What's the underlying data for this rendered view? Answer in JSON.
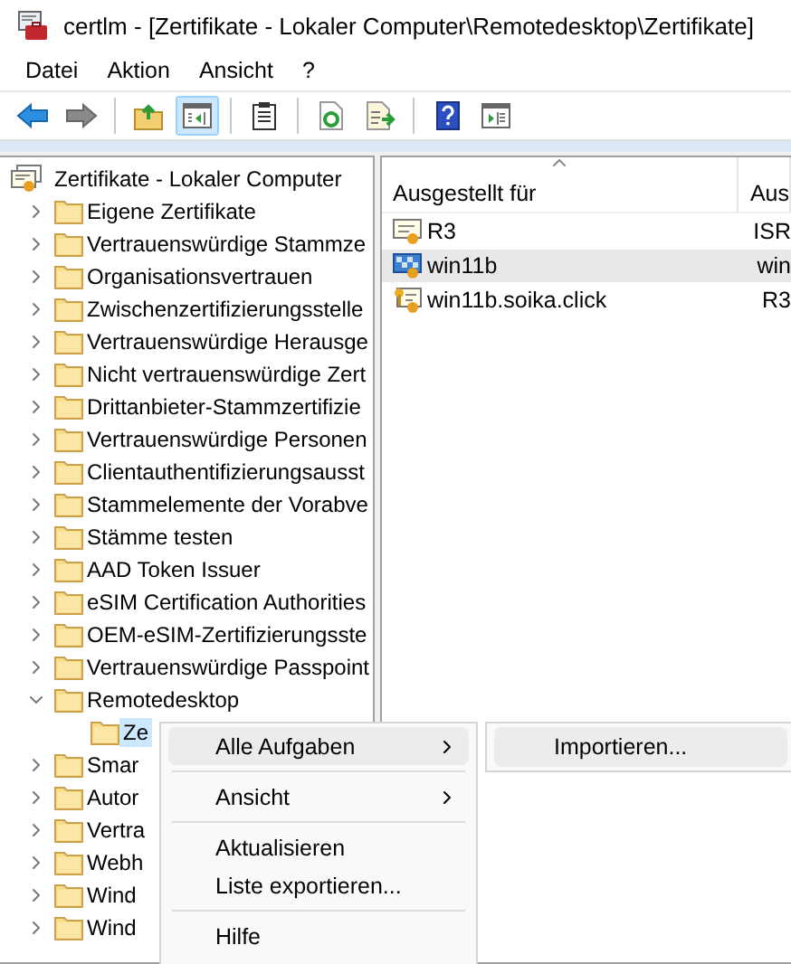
{
  "window": {
    "title": "certlm - [Zertifikate - Lokaler Computer\\Remotedesktop\\Zertifikate]"
  },
  "menu": [
    "Datei",
    "Aktion",
    "Ansicht",
    "?"
  ],
  "toolbar": [
    {
      "kind": "back",
      "selected": false
    },
    {
      "kind": "forward",
      "selected": false
    },
    {
      "kind": "separator"
    },
    {
      "kind": "up",
      "selected": false
    },
    {
      "kind": "tree",
      "selected": true
    },
    {
      "kind": "separator"
    },
    {
      "kind": "clipboard",
      "selected": false
    },
    {
      "kind": "separator"
    },
    {
      "kind": "refresh",
      "selected": false
    },
    {
      "kind": "export",
      "selected": false
    },
    {
      "kind": "separator"
    },
    {
      "kind": "help",
      "selected": false
    },
    {
      "kind": "pane",
      "selected": false
    }
  ],
  "tree": {
    "label": "Zertifikate - Lokaler Computer",
    "children": [
      {
        "label": "Eigene Zertifikate",
        "expanded": false,
        "selected": false
      },
      {
        "label": "Vertrauenswürdige Stammze",
        "expanded": false,
        "selected": false
      },
      {
        "label": "Organisationsvertrauen",
        "expanded": false,
        "selected": false
      },
      {
        "label": "Zwischenzertifizierungsstelle",
        "expanded": false,
        "selected": false
      },
      {
        "label": "Vertrauenswürdige Herausge",
        "expanded": false,
        "selected": false
      },
      {
        "label": "Nicht vertrauenswürdige Zert",
        "expanded": false,
        "selected": false
      },
      {
        "label": "Drittanbieter-Stammzertifizie",
        "expanded": false,
        "selected": false
      },
      {
        "label": "Vertrauenswürdige Personen",
        "expanded": false,
        "selected": false
      },
      {
        "label": "Clientauthentifizierungsausst",
        "expanded": false,
        "selected": false
      },
      {
        "label": "Stammelemente der Vorabve",
        "expanded": false,
        "selected": false
      },
      {
        "label": "Stämme testen",
        "expanded": false,
        "selected": false
      },
      {
        "label": "AAD Token Issuer",
        "expanded": false,
        "selected": false
      },
      {
        "label": "eSIM Certification Authorities",
        "expanded": false,
        "selected": false
      },
      {
        "label": "OEM-eSIM-Zertifizierungsste",
        "expanded": false,
        "selected": false
      },
      {
        "label": "Vertrauenswürdige Passpoint",
        "expanded": false,
        "selected": false
      },
      {
        "label": "Remotedesktop",
        "expanded": true,
        "selected": false,
        "children": [
          {
            "label": "Ze",
            "selected": true
          }
        ]
      },
      {
        "label": "Smar",
        "expanded": false,
        "selected": false
      },
      {
        "label": "Autor",
        "expanded": false,
        "selected": false
      },
      {
        "label": "Vertra",
        "expanded": false,
        "selected": false
      },
      {
        "label": "Webh",
        "expanded": false,
        "selected": false
      },
      {
        "label": "Wind",
        "expanded": false,
        "selected": false
      },
      {
        "label": "Wind",
        "expanded": false,
        "selected": false
      }
    ]
  },
  "list": {
    "columns": [
      {
        "label": "Ausgestellt für",
        "sorted": true
      },
      {
        "label": "Aus",
        "sorted": false
      }
    ],
    "rows": [
      {
        "kind": "cert",
        "cells": [
          "R3",
          "ISR"
        ],
        "selected": false
      },
      {
        "kind": "checkered",
        "cells": [
          "win11b",
          "win"
        ],
        "selected": true
      },
      {
        "kind": "key",
        "cells": [
          "win11b.soika.click",
          "R3"
        ],
        "selected": false
      }
    ]
  },
  "context_menu": {
    "items": [
      {
        "kind": "item",
        "label": "Alle Aufgaben",
        "submenu": true,
        "selected": true
      },
      {
        "kind": "separator"
      },
      {
        "kind": "item",
        "label": "Ansicht",
        "submenu": true,
        "selected": false
      },
      {
        "kind": "separator"
      },
      {
        "kind": "item",
        "label": "Aktualisieren",
        "submenu": false,
        "selected": false
      },
      {
        "kind": "item",
        "label": "Liste exportieren...",
        "submenu": false,
        "selected": false
      },
      {
        "kind": "separator"
      },
      {
        "kind": "item",
        "label": "Hilfe",
        "submenu": false,
        "selected": false
      }
    ],
    "submenu": [
      {
        "label": "Importieren...",
        "selected": true
      }
    ]
  }
}
